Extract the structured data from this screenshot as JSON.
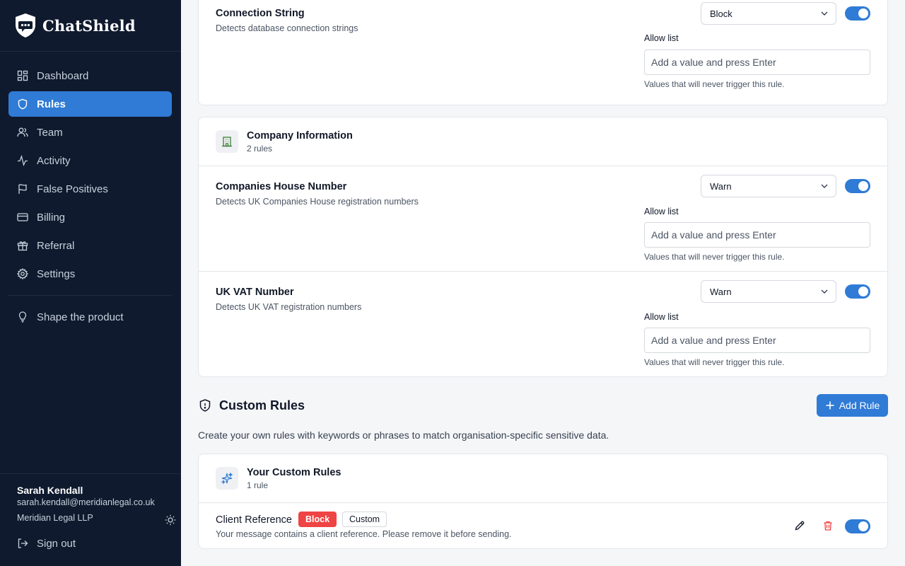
{
  "brand": {
    "name": "ChatShield"
  },
  "nav": {
    "items": [
      {
        "label": "Dashboard",
        "icon": "dashboard-icon"
      },
      {
        "label": "Rules",
        "icon": "shield-icon",
        "active": true
      },
      {
        "label": "Team",
        "icon": "users-icon"
      },
      {
        "label": "Activity",
        "icon": "activity-icon"
      },
      {
        "label": "False Positives",
        "icon": "flag-icon"
      },
      {
        "label": "Billing",
        "icon": "credit-card-icon"
      },
      {
        "label": "Referral",
        "icon": "gift-icon"
      },
      {
        "label": "Settings",
        "icon": "gear-icon"
      }
    ],
    "extra": {
      "label": "Shape the product",
      "icon": "lightbulb-icon"
    }
  },
  "user": {
    "name": "Sarah Kendall",
    "email": "sarah.kendall@meridianlegal.co.uk",
    "org": "Meridian Legal LLP",
    "signout_label": "Sign out"
  },
  "rules_top": {
    "connection_string": {
      "name": "Connection String",
      "description": "Detects database connection strings",
      "action": "Block",
      "enabled": true
    }
  },
  "allow_list": {
    "label": "Allow list",
    "placeholder": "Add a value and press Enter",
    "help": "Values that will never trigger this rule."
  },
  "company_group": {
    "title": "Company Information",
    "count": "2 rules",
    "rules": [
      {
        "name": "Companies House Number",
        "description": "Detects UK Companies House registration numbers",
        "action": "Warn",
        "enabled": true
      },
      {
        "name": "UK VAT Number",
        "description": "Detects UK VAT registration numbers",
        "action": "Warn",
        "enabled": true
      }
    ]
  },
  "custom_rules": {
    "title": "Custom Rules",
    "add_label": "Add Rule",
    "description": "Create your own rules with keywords or phrases to match organisation-specific sensitive data.",
    "group_title": "Your Custom Rules",
    "group_count": "1 rule",
    "items": [
      {
        "name": "Client Reference",
        "badge_action": "Block",
        "badge_type": "Custom",
        "message": "Your message contains a client reference. Please remove it before sending.",
        "enabled": true
      }
    ]
  },
  "colors": {
    "accent": "#2f7bd6",
    "sidebar_bg": "#0f1a2e",
    "danger": "#ef4444"
  }
}
